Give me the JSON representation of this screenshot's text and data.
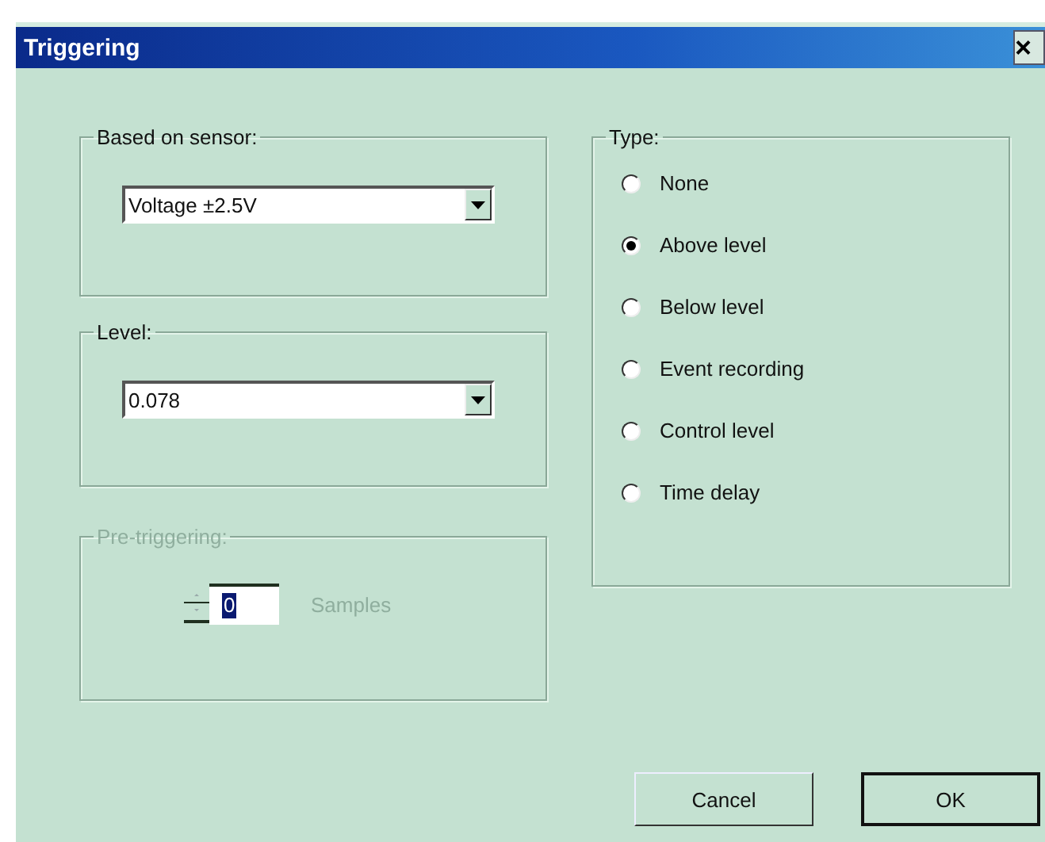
{
  "window": {
    "title": "Triggering",
    "close": "×"
  },
  "sensor": {
    "label": "Based on sensor:",
    "value": "Voltage ±2.5V"
  },
  "level": {
    "label": "Level:",
    "value": "0.078"
  },
  "pretrigger": {
    "label": "Pre-triggering:",
    "disabled": true,
    "value": "0",
    "unit": "Samples"
  },
  "type": {
    "label": "Type:",
    "options": [
      {
        "label": "None",
        "selected": false
      },
      {
        "label": "Above level",
        "selected": true
      },
      {
        "label": "Below level",
        "selected": false
      },
      {
        "label": "Event recording",
        "selected": false
      },
      {
        "label": "Control level",
        "selected": false
      },
      {
        "label": "Time delay",
        "selected": false
      }
    ]
  },
  "buttons": [
    {
      "label": "Cancel",
      "default": false
    },
    {
      "label": "OK",
      "default": true
    }
  ]
}
